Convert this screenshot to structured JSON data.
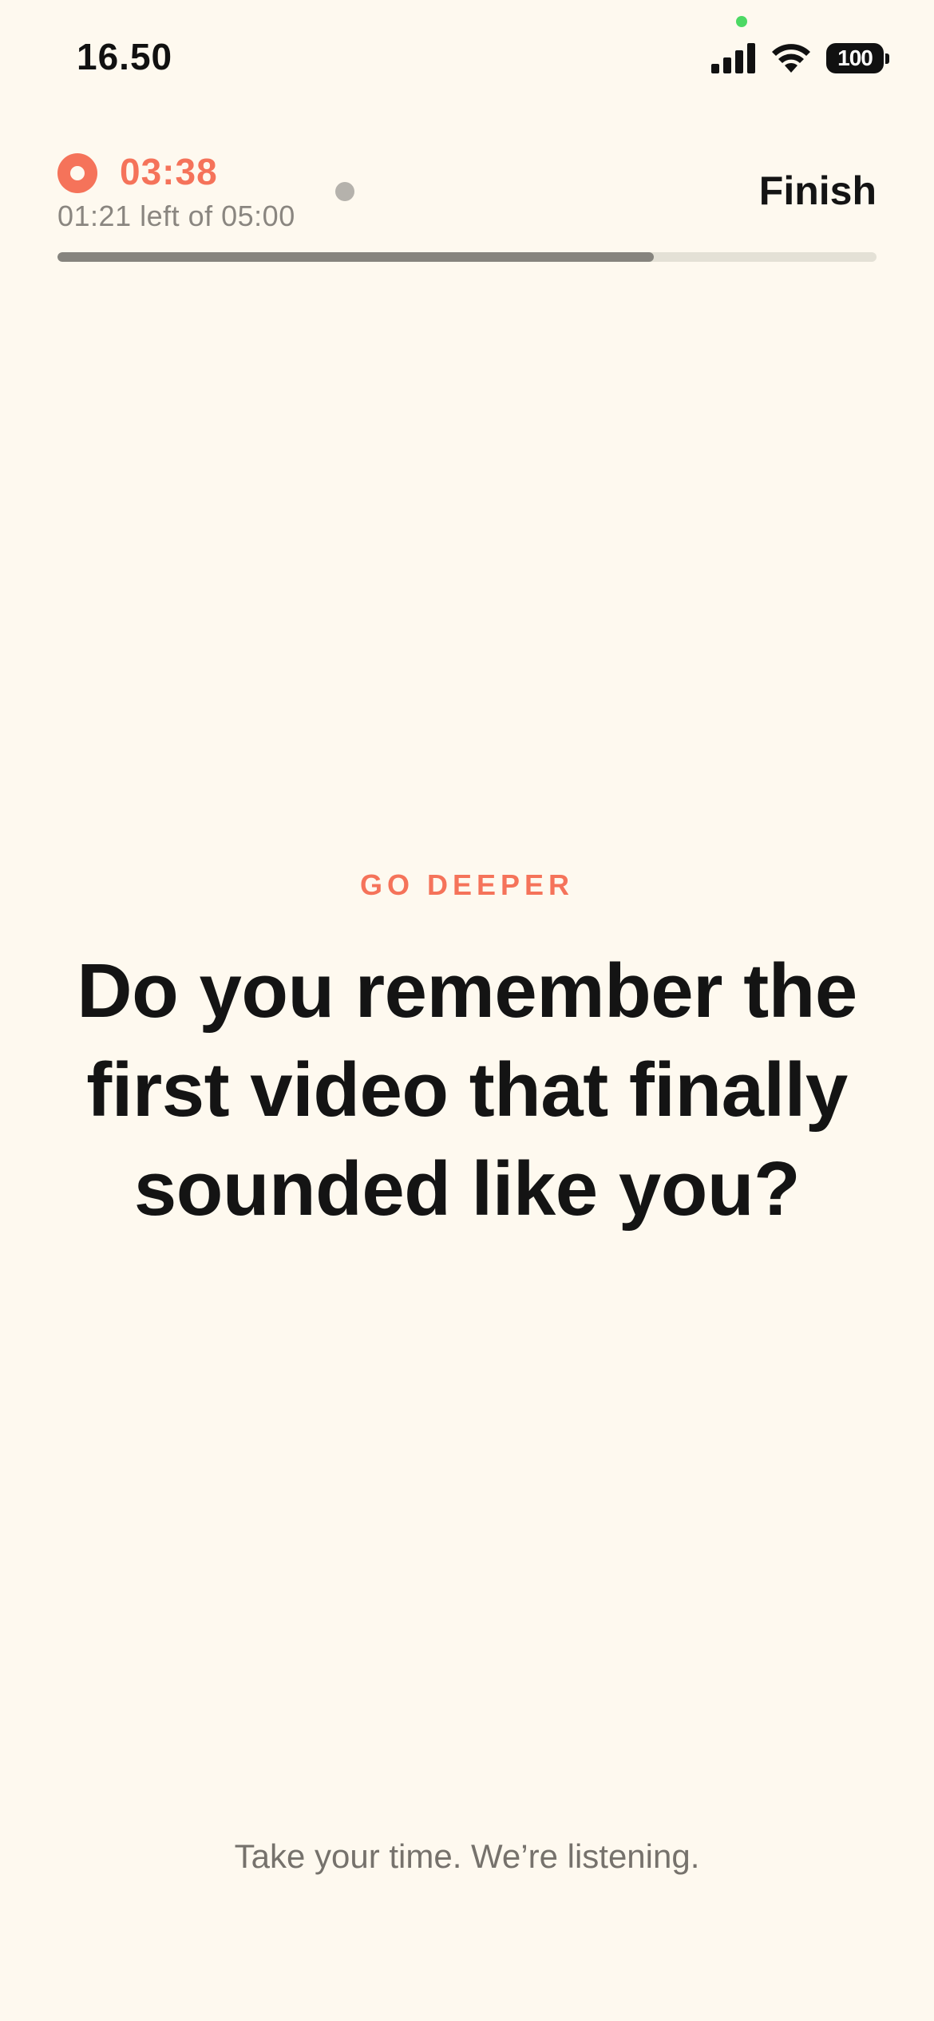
{
  "status_bar": {
    "time": "16.50",
    "battery_level": "100",
    "icons": [
      "signal-icon",
      "wifi-icon",
      "battery-icon"
    ],
    "privacy_dot_color": "#4CD964"
  },
  "recording": {
    "elapsed": "03:38",
    "remaining_text": "01:21 left of 05:00",
    "progress_fraction": 0.728,
    "finish_label": "Finish",
    "colors": {
      "accent": "#F5735A",
      "progress_fill": "#86847E",
      "progress_track": "#E4E1D6",
      "mode_dot": "#B5B2AC"
    }
  },
  "prompt": {
    "label": "GO DEEPER",
    "question": "Do you remember the first video that finally sounded like you?"
  },
  "footer": {
    "text": "Take your time. We’re listening."
  },
  "theme": {
    "background": "#FEF9EF",
    "text": "#141414"
  }
}
